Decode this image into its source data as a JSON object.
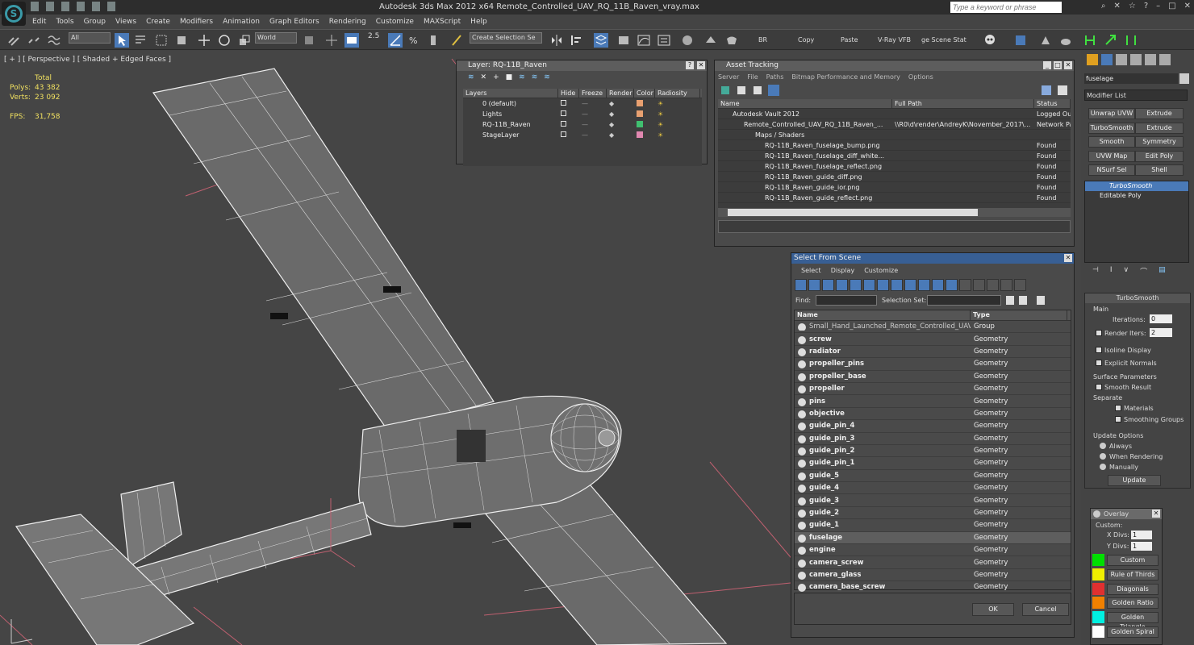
{
  "app": {
    "title": "Autodesk 3ds Max  2012 x64      Remote_Controlled_UAV_RQ_11B_Raven_vray.max",
    "search_placeholder": "Type a keyword or phrase"
  },
  "menu": [
    "Edit",
    "Tools",
    "Group",
    "Views",
    "Create",
    "Modifiers",
    "Animation",
    "Graph Editors",
    "Rendering",
    "Customize",
    "MAXScript",
    "Help"
  ],
  "toolbar": {
    "filter": "All",
    "refcoord": "World",
    "snap_value": "2.5",
    "named_sel": "Create Selection Se",
    "br": "BR",
    "copy": "Copy",
    "paste": "Paste",
    "vray": "V-Ray VFB",
    "stat": "ge Scene Stat"
  },
  "viewport": {
    "label": "[ + ] [ Perspective ] [ Shaded + Edged Faces ]",
    "stats": {
      "total": "Total",
      "polys_label": "Polys:",
      "polys": "43 382",
      "verts_label": "Verts:",
      "verts": "23 092",
      "fps_label": "FPS:",
      "fps": "31,758"
    }
  },
  "layer_panel": {
    "title": "Layer: RQ-11B_Raven",
    "cols": [
      "Layers",
      "Hide",
      "Freeze",
      "Render",
      "Color",
      "Radiosity"
    ],
    "rows": [
      {
        "name": "0 (default)",
        "color": "#e8a070"
      },
      {
        "name": "Lights",
        "color": "#e8a070"
      },
      {
        "name": "RQ-11B_Raven",
        "color": "#40c070"
      },
      {
        "name": "StageLayer",
        "color": "#e088b0"
      }
    ]
  },
  "asset_panel": {
    "title": "Asset Tracking",
    "menu": [
      "Server",
      "File",
      "Paths",
      "Bitmap Performance and Memory",
      "Options"
    ],
    "cols": [
      "Name",
      "Full Path",
      "Status"
    ],
    "rows": [
      {
        "name": "Autodesk Vault 2012",
        "path": "",
        "status": "Logged Ou"
      },
      {
        "name": "Remote_Controlled_UAV_RQ_11B_Raven_...",
        "path": "\\\\R0\\d\\render\\AndreyK\\November_2017\\...",
        "status": "Network Pa"
      },
      {
        "name": "Maps / Shaders",
        "path": "",
        "status": ""
      },
      {
        "name": "RQ-11B_Raven_fuselage_bump.png",
        "path": "",
        "status": "Found"
      },
      {
        "name": "RQ-11B_Raven_fuselage_diff_white...",
        "path": "",
        "status": "Found"
      },
      {
        "name": "RQ-11B_Raven_fuselage_reflect.png",
        "path": "",
        "status": "Found"
      },
      {
        "name": "RQ-11B_Raven_guide_diff.png",
        "path": "",
        "status": "Found"
      },
      {
        "name": "RQ-11B_Raven_guide_ior.png",
        "path": "",
        "status": "Found"
      },
      {
        "name": "RQ-11B_Raven_guide_reflect.png",
        "path": "",
        "status": "Found"
      }
    ]
  },
  "sfs": {
    "title": "Select From Scene",
    "menu": [
      "Select",
      "Display",
      "Customize"
    ],
    "find": "Find:",
    "selset": "Selection Set:",
    "cols": [
      "Name",
      "Type"
    ],
    "group": {
      "name": "Small_Hand_Launched_Remote_Controlled_UAV_R...",
      "type": "Group"
    },
    "rows": [
      {
        "name": "screw",
        "type": "Geometry"
      },
      {
        "name": "radiator",
        "type": "Geometry"
      },
      {
        "name": "propeller_pins",
        "type": "Geometry"
      },
      {
        "name": "propeller_base",
        "type": "Geometry"
      },
      {
        "name": "propeller",
        "type": "Geometry"
      },
      {
        "name": "pins",
        "type": "Geometry"
      },
      {
        "name": "objective",
        "type": "Geometry"
      },
      {
        "name": "guide_pin_4",
        "type": "Geometry"
      },
      {
        "name": "guide_pin_3",
        "type": "Geometry"
      },
      {
        "name": "guide_pin_2",
        "type": "Geometry"
      },
      {
        "name": "guide_pin_1",
        "type": "Geometry"
      },
      {
        "name": "guide_5",
        "type": "Geometry"
      },
      {
        "name": "guide_4",
        "type": "Geometry"
      },
      {
        "name": "guide_3",
        "type": "Geometry"
      },
      {
        "name": "guide_2",
        "type": "Geometry"
      },
      {
        "name": "guide_1",
        "type": "Geometry"
      },
      {
        "name": "fuselage",
        "type": "Geometry"
      },
      {
        "name": "engine",
        "type": "Geometry"
      },
      {
        "name": "camera_screw",
        "type": "Geometry"
      },
      {
        "name": "camera_glass",
        "type": "Geometry"
      },
      {
        "name": "camera_base_screw",
        "type": "Geometry"
      }
    ],
    "ok": "OK",
    "cancel": "Cancel"
  },
  "cmd": {
    "objname": "fuselage",
    "modlist": "Modifier List",
    "buttons": [
      "Unwrap UVW",
      "Extrude",
      "TurboSmooth",
      "Extrude",
      "Smooth",
      "Symmetry",
      "UVW Map",
      "Edit Poly",
      "NSurf Sel",
      "Shell"
    ],
    "stack": [
      "TurboSmooth",
      "Editable Poly"
    ],
    "ts": {
      "title": "TurboSmooth",
      "main": "Main",
      "iter_label": "Iterations:",
      "iter": "0",
      "render_label": "Render Iters:",
      "render": "2",
      "isoline": "Isoline Display",
      "explicit": "Explicit Normals",
      "surface": "Surface Parameters",
      "smooth_result": "Smooth Result",
      "separate": "Separate",
      "materials": "Materials",
      "smoothing": "Smoothing Groups",
      "update_opts": "Update Options",
      "always": "Always",
      "when_render": "When Rendering",
      "manually": "Manually",
      "update": "Update"
    },
    "overlay": {
      "title": "Overlay",
      "custom": "Custom:",
      "xdivs_label": "X Divs:",
      "xdivs": "1",
      "ydivs_label": "Y Divs:",
      "ydivs": "1",
      "items": [
        {
          "label": "Custom",
          "color": "#00e000"
        },
        {
          "label": "Rule of Thirds",
          "color": "#f0f000"
        },
        {
          "label": "Diagonals",
          "color": "#e03030"
        },
        {
          "label": "Golden Ratio",
          "color": "#f08000"
        },
        {
          "label": "Golden Triangle",
          "color": "#00f0e0"
        },
        {
          "label": "Golden Spiral",
          "color": "#ffffff"
        }
      ]
    }
  }
}
